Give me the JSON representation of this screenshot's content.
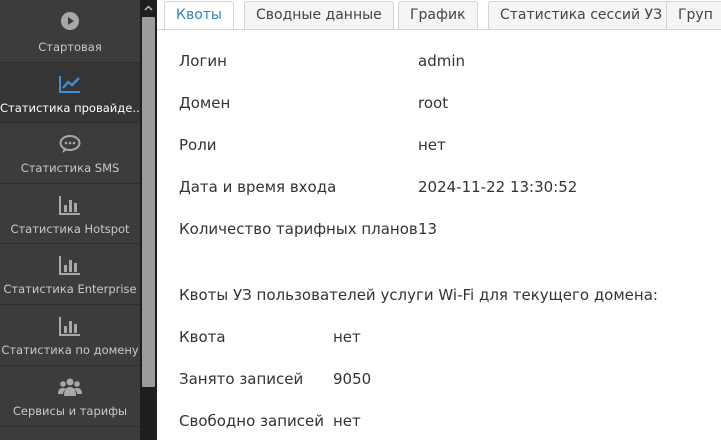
{
  "sidebar": {
    "items": [
      {
        "label": "Стартовая",
        "icon": "play-circle-icon"
      },
      {
        "label": "Статистика провайде…",
        "icon": "line-chart-icon"
      },
      {
        "label": "Статистика SMS",
        "icon": "chat-bubble-icon"
      },
      {
        "label": "Статистика Hotspot",
        "icon": "bar-chart-icon"
      },
      {
        "label": "Статистика Enterprise",
        "icon": "bar-chart-icon"
      },
      {
        "label": "Статистика по домену",
        "icon": "bar-chart-icon"
      },
      {
        "label": "Сервисы и тарифы",
        "icon": "users-icon"
      }
    ],
    "active_index": 1,
    "colors": {
      "background": "#3c3c3c",
      "active_icon": "#3d8fd6",
      "icon": "#a8a8a8"
    }
  },
  "tabs": [
    {
      "label": "Квоты"
    },
    {
      "label": "Сводные данные"
    },
    {
      "label": "График"
    },
    {
      "label": "Статистика сессий УЗ"
    },
    {
      "label": "Груп"
    }
  ],
  "info": {
    "login_label": "Логин",
    "login_value": "admin",
    "domain_label": "Домен",
    "domain_value": "root",
    "roles_label": "Роли",
    "roles_value": "нет",
    "datetime_label": "Дата и время входа",
    "datetime_value": "2024-11-22 13:30:52",
    "plans_label": "Количество тарифных планов",
    "plans_value": "13"
  },
  "quotas": {
    "title": "Квоты УЗ пользователей услуги Wi-Fi для текущего домена:",
    "quota_label": "Квота",
    "quota_value": "нет",
    "used_label": "Занято записей",
    "used_value": "9050",
    "free_label": "Свободно записей",
    "free_value": "нет"
  },
  "accent_color": "#2c86c9"
}
